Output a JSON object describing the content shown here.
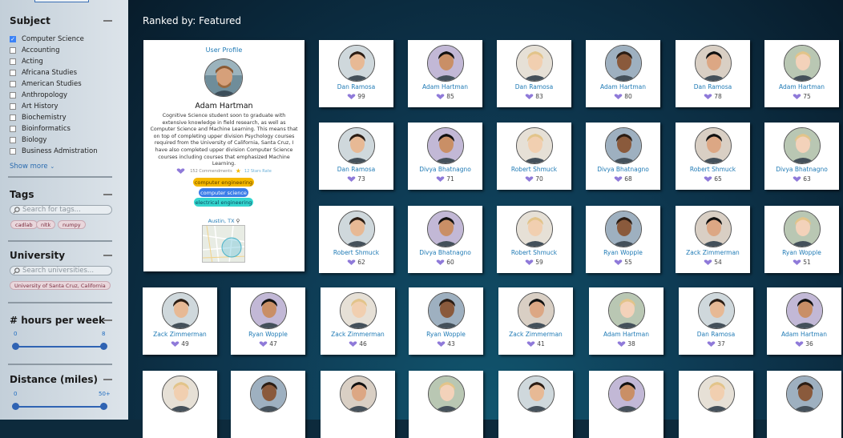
{
  "sidebar": {
    "subject": {
      "title": "Subject",
      "items": [
        {
          "label": "Computer Science",
          "checked": true
        },
        {
          "label": "Accounting",
          "checked": false
        },
        {
          "label": "Acting",
          "checked": false
        },
        {
          "label": "Africana Studies",
          "checked": false
        },
        {
          "label": "American Studies",
          "checked": false
        },
        {
          "label": "Anthropology",
          "checked": false
        },
        {
          "label": "Art History",
          "checked": false
        },
        {
          "label": "Biochemistry",
          "checked": false
        },
        {
          "label": "Bioinformatics",
          "checked": false
        },
        {
          "label": "Biology",
          "checked": false
        },
        {
          "label": "Business Admistration",
          "checked": false
        }
      ],
      "show_more": "Show more"
    },
    "tags": {
      "title": "Tags",
      "placeholder": "Search for tags...",
      "chips": [
        "cadlab",
        "nltk",
        "numpy"
      ]
    },
    "university": {
      "title": "University",
      "placeholder": "Search universities...",
      "chips": [
        "University of Santa Cruz, California"
      ]
    },
    "hours": {
      "title": "# hours per week",
      "min_label": "0",
      "max_label": "8",
      "range": [
        0,
        8
      ]
    },
    "distance": {
      "title": "Distance (miles)",
      "min_label": "0",
      "max_label": "50+",
      "range": [
        0,
        50
      ]
    }
  },
  "main": {
    "ranked_by": "Ranked by: Featured",
    "profile": {
      "heading": "User Profile",
      "name": "Adam Hartman",
      "bio": "Cognitive Science student soon to graduate with extensive knowledge in field research, as well as Computer Science and Machine Learning. This means that on top of completing upper division Psychology courses required from the University of California, Santa Cruz, I have also completed upper division Computer Science courses including courses that emphasized Machine Learning.",
      "comments": "152 Commendments",
      "stars": "12 Stars Rate",
      "tags": [
        {
          "label": "computer engineering",
          "color": "#f5b800"
        },
        {
          "label": "computer science",
          "color": "#3b7de8"
        },
        {
          "label": "electrical engineering",
          "color": "#34d6cf"
        }
      ],
      "location": "Austin, TX"
    },
    "cards": [
      {
        "name": "Dan Ramosa",
        "score": "99"
      },
      {
        "name": "Adam Hartman",
        "score": "85"
      },
      {
        "name": "Dan Ramosa",
        "score": "83"
      },
      {
        "name": "Adam Hartman",
        "score": "80"
      },
      {
        "name": "Dan Ramosa",
        "score": "78"
      },
      {
        "name": "Adam Hartman",
        "score": "75"
      },
      {
        "name": "Dan Ramosa",
        "score": "73"
      },
      {
        "name": "Divya Bhatnagno",
        "score": "71"
      },
      {
        "name": "Robert Shmuck",
        "score": "70"
      },
      {
        "name": "Divya Bhatnagno",
        "score": "68"
      },
      {
        "name": "Robert Shmuck",
        "score": "65"
      },
      {
        "name": "Divya Bhatnagno",
        "score": "63"
      },
      {
        "name": "Robert Shmuck",
        "score": "62"
      },
      {
        "name": "Divya Bhatnagno",
        "score": "60"
      },
      {
        "name": "Robert Shmuck",
        "score": "59"
      },
      {
        "name": "Ryan Wopple",
        "score": "55"
      },
      {
        "name": "Zack Zimmerman",
        "score": "54"
      },
      {
        "name": "Ryan Wopple",
        "score": "51"
      },
      {
        "name": "Zack Zimmerman",
        "score": "49"
      },
      {
        "name": "Ryan Wopple",
        "score": "47"
      },
      {
        "name": "Zack Zimmerman",
        "score": "46"
      },
      {
        "name": "Ryan Wopple",
        "score": "43"
      },
      {
        "name": "Zack Zimmerman",
        "score": "41"
      },
      {
        "name": "Adam Hartman",
        "score": "38"
      },
      {
        "name": "Dan Ramosa",
        "score": "37"
      },
      {
        "name": "Adam Hartman",
        "score": "36"
      },
      {
        "name": "",
        "score": ""
      },
      {
        "name": "",
        "score": ""
      },
      {
        "name": "",
        "score": ""
      },
      {
        "name": "",
        "score": ""
      },
      {
        "name": "",
        "score": ""
      },
      {
        "name": "",
        "score": ""
      },
      {
        "name": "",
        "score": ""
      },
      {
        "name": "",
        "score": ""
      }
    ]
  }
}
